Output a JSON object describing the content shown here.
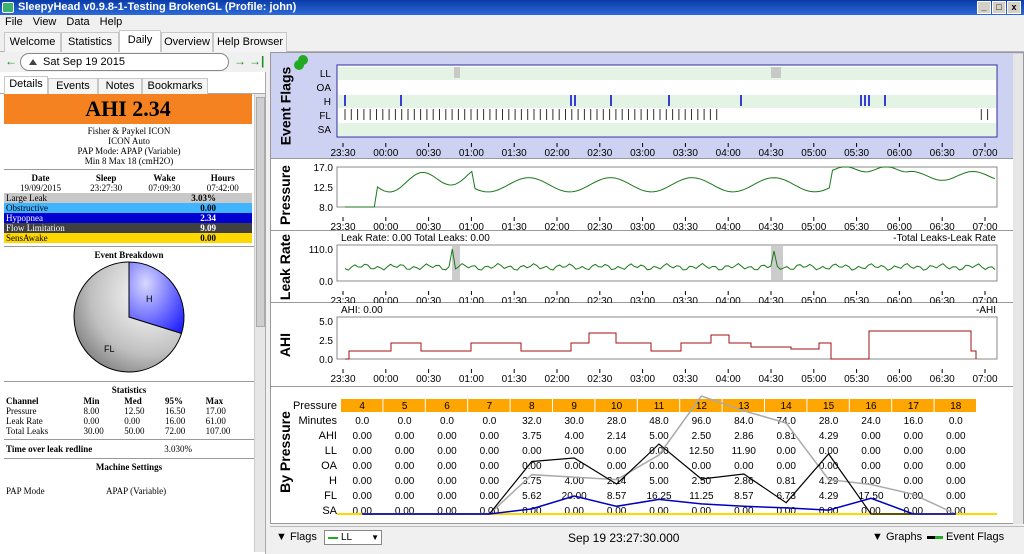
{
  "window": {
    "title": "SleepyHead v0.9.8-1-Testing BrokenGL (Profile: john)"
  },
  "menu": [
    "File",
    "View",
    "Data",
    "Help"
  ],
  "main_tabs": [
    "Welcome",
    "Statistics",
    "Daily",
    "Overview",
    "Help Browser"
  ],
  "date_bar": {
    "date": "Sat Sep 19 2015"
  },
  "sub_tabs": [
    "Details",
    "Events",
    "Notes",
    "Bookmarks"
  ],
  "details": {
    "ahi_label": "AHI 2.34",
    "machine_lines": [
      "Fisher & Paykel ICON",
      "ICON Auto",
      "PAP Mode: APAP (Variable)",
      "Min 8 Max 18 (cmH2O)"
    ],
    "session_headers": [
      "Date",
      "Sleep",
      "Wake",
      "Hours"
    ],
    "session_row": [
      "19/09/2015",
      "23:27:30",
      "07:09:30",
      "07:42:00"
    ],
    "event_rows": [
      {
        "name": "Large Leak",
        "value": "3.03%",
        "bg": "#c8c8c8",
        "fg": "#000"
      },
      {
        "name": "Obstructive",
        "value": "0.00",
        "bg": "#40b4ff",
        "fg": "#000"
      },
      {
        "name": "Hypopnea",
        "value": "2.34",
        "bg": "#0000d0",
        "fg": "#fff"
      },
      {
        "name": "Flow Limitation",
        "value": "9.09",
        "bg": "#404040",
        "fg": "#fff"
      },
      {
        "name": "SensAwake",
        "value": "0.00",
        "bg": "#ffd800",
        "fg": "#000"
      }
    ],
    "pie_title": "Event Breakdown",
    "pie_labels": {
      "h": "H",
      "fl": "FL"
    },
    "stats_title": "Statistics",
    "stats_headers": [
      "Channel",
      "Min",
      "Med",
      "95%",
      "Max"
    ],
    "stats_rows": [
      [
        "Pressure",
        "8.00",
        "12.50",
        "16.50",
        "17.00"
      ],
      [
        "Leak Rate",
        "0.00",
        "0.00",
        "16.00",
        "61.00"
      ],
      [
        "Total Leaks",
        "30.00",
        "50.00",
        "72.00",
        "107.00"
      ]
    ],
    "leak_redline_label": "Time over leak redline",
    "leak_redline_value": "3.030%",
    "machine_settings_title": "Machine Settings",
    "pap_mode_label": "PAP Mode",
    "pap_mode_value": "APAP (Variable)"
  },
  "time_ticks": [
    "23:30",
    "00:00",
    "00:30",
    "01:00",
    "01:30",
    "02:00",
    "02:30",
    "03:00",
    "03:30",
    "04:00",
    "04:30",
    "05:00",
    "05:30",
    "06:00",
    "06:30",
    "07:00"
  ],
  "graphs": {
    "event_flags": {
      "title": "Event Flags",
      "rows": [
        "LL",
        "OA",
        "H",
        "FL",
        "SA"
      ]
    },
    "pressure": {
      "title": "Pressure",
      "yticks": [
        "17.0",
        "12.5",
        "8.0"
      ]
    },
    "leak": {
      "title": "Leak Rate",
      "yticks": [
        "110.0",
        "0.0"
      ],
      "header": "Leak Rate: 0.00 Total Leaks: 0.00",
      "legend": "-Total Leaks-Leak Rate"
    },
    "ahi": {
      "title": "AHI",
      "yticks": [
        "5.0",
        "2.5",
        "0.0"
      ],
      "header": "AHI: 0.00",
      "legend": "-AHI"
    },
    "by_pressure": {
      "title": "By Pressure",
      "header_label": "Pressure",
      "pressures": [
        "4",
        "5",
        "6",
        "7",
        "8",
        "9",
        "10",
        "11",
        "12",
        "13",
        "14",
        "15",
        "16",
        "17",
        "18"
      ],
      "rows": [
        {
          "label": "Minutes",
          "values": [
            "0.0",
            "0.0",
            "0.0",
            "0.0",
            "32.0",
            "30.0",
            "28.0",
            "48.0",
            "96.0",
            "84.0",
            "74.0",
            "28.0",
            "24.0",
            "16.0",
            "0.0"
          ]
        },
        {
          "label": "AHI",
          "values": [
            "0.00",
            "0.00",
            "0.00",
            "0.00",
            "3.75",
            "4.00",
            "2.14",
            "5.00",
            "2.50",
            "2.86",
            "0.81",
            "4.29",
            "0.00",
            "0.00",
            "0.00"
          ]
        },
        {
          "label": "LL",
          "values": [
            "0.00",
            "0.00",
            "0.00",
            "0.00",
            "0.00",
            "0.00",
            "0.00",
            "0.00",
            "12.50",
            "11.90",
            "0.00",
            "0.00",
            "0.00",
            "0.00",
            "0.00"
          ]
        },
        {
          "label": "OA",
          "values": [
            "0.00",
            "0.00",
            "0.00",
            "0.00",
            "0.00",
            "0.00",
            "0.00",
            "0.00",
            "0.00",
            "0.00",
            "0.00",
            "0.00",
            "0.00",
            "0.00",
            "0.00"
          ]
        },
        {
          "label": "H",
          "values": [
            "0.00",
            "0.00",
            "0.00",
            "0.00",
            "3.75",
            "4.00",
            "2.14",
            "5.00",
            "2.50",
            "2.86",
            "0.81",
            "4.29",
            "0.00",
            "0.00",
            "0.00"
          ]
        },
        {
          "label": "FL",
          "values": [
            "0.00",
            "0.00",
            "0.00",
            "0.00",
            "5.62",
            "20.00",
            "8.57",
            "16.25",
            "11.25",
            "8.57",
            "6.73",
            "4.29",
            "17.50",
            "0.00",
            "0.00"
          ]
        },
        {
          "label": "SA",
          "values": [
            "0.00",
            "0.00",
            "0.00",
            "0.00",
            "0.00",
            "0.00",
            "0.00",
            "0.00",
            "0.00",
            "0.00",
            "0.00",
            "0.00",
            "0.00",
            "0.00",
            "0.00"
          ]
        }
      ]
    }
  },
  "bottom": {
    "flags_label": "Flags",
    "flag_combo": "LL",
    "timestamp": "Sep 19 23:27:30.000",
    "graphs_label": "Graphs",
    "event_flags_label": "Event Flags"
  },
  "colors": {
    "ahi_box": "#f58220",
    "pressure_line": "#1a7a1a",
    "ahi_line": "#a01010",
    "hypopnea": "#0000d0",
    "by_pressure_header": "#ffa500"
  }
}
